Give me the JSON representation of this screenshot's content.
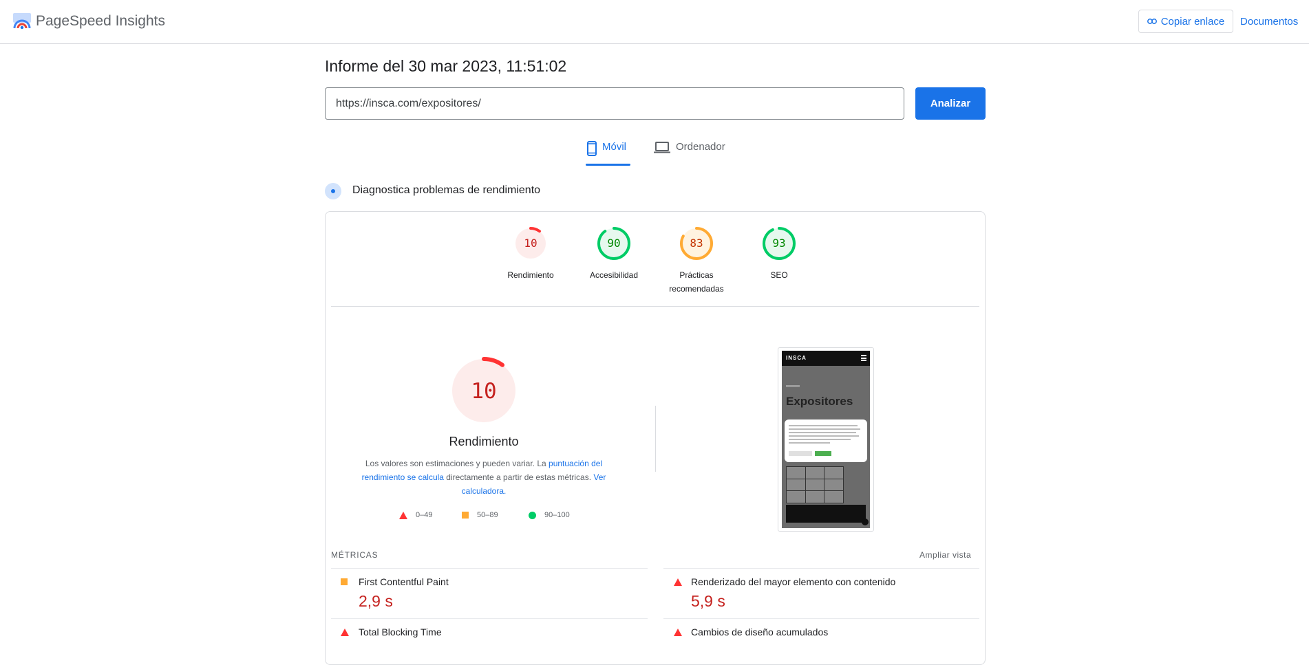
{
  "header": {
    "app_title": "PageSpeed Insights",
    "copy_link_label": "Copiar enlace",
    "docs_label": "Documentos"
  },
  "report": {
    "title": "Informe del 30 mar 2023, 11:51:02",
    "url_value": "https://insca.com/expositores/",
    "analyze_label": "Analizar"
  },
  "tabs": [
    {
      "label": "Móvil",
      "active": true,
      "icon": "smartphone-icon"
    },
    {
      "label": "Ordenador",
      "active": false,
      "icon": "laptop-icon"
    }
  ],
  "diagnostics": {
    "title": "Diagnostica problemas de rendimiento"
  },
  "scores": [
    {
      "score": "10",
      "label": "Rendimiento",
      "fraction": 0.1,
      "status": "fail"
    },
    {
      "score": "90",
      "label": "Accesibilidad",
      "fraction": 0.9,
      "status": "pass"
    },
    {
      "score": "83",
      "label": "Prácticas recomendadas",
      "fraction": 0.83,
      "status": "average"
    },
    {
      "score": "93",
      "label": "SEO",
      "fraction": 0.93,
      "status": "pass"
    }
  ],
  "status_colors": {
    "fail": {
      "stroke": "#ff3333",
      "fill": "#fdeceb",
      "text": "#c5221f"
    },
    "average": {
      "stroke": "#ffaa33",
      "fill": "#fff3e0",
      "text": "#c33300"
    },
    "pass": {
      "stroke": "#00cc66",
      "fill": "#e6f8ee",
      "text": "#008800"
    }
  },
  "performance": {
    "score": "10",
    "fraction": 0.1,
    "title": "Rendimiento",
    "desc_1": "Los valores son estimaciones y pueden variar. La ",
    "desc_link_1": "puntuación del rendimiento se calcula",
    "desc_2": " directamente a partir de estas métricas. ",
    "desc_link_2": "Ver calculadora",
    "desc_3": "."
  },
  "legend": [
    {
      "range": "0–49",
      "icon": "triangle-icon"
    },
    {
      "range": "50–89",
      "icon": "square-icon"
    },
    {
      "range": "90–100",
      "icon": "circle-icon"
    }
  ],
  "screenshot": {
    "brand": "INSCA",
    "heading": "Expositores"
  },
  "metrics": {
    "section_label": "MÉTRICAS",
    "expand_label": "Ampliar vista",
    "items": [
      {
        "title": "First Contentful Paint",
        "value": "2,9 s",
        "status": "average"
      },
      {
        "title": "Renderizado del mayor elemento con contenido",
        "value": "5,9 s",
        "status": "fail"
      },
      {
        "title": "Total Blocking Time",
        "value": "",
        "status": "fail"
      },
      {
        "title": "Cambios de diseño acumulados",
        "value": "",
        "status": "fail"
      }
    ]
  }
}
